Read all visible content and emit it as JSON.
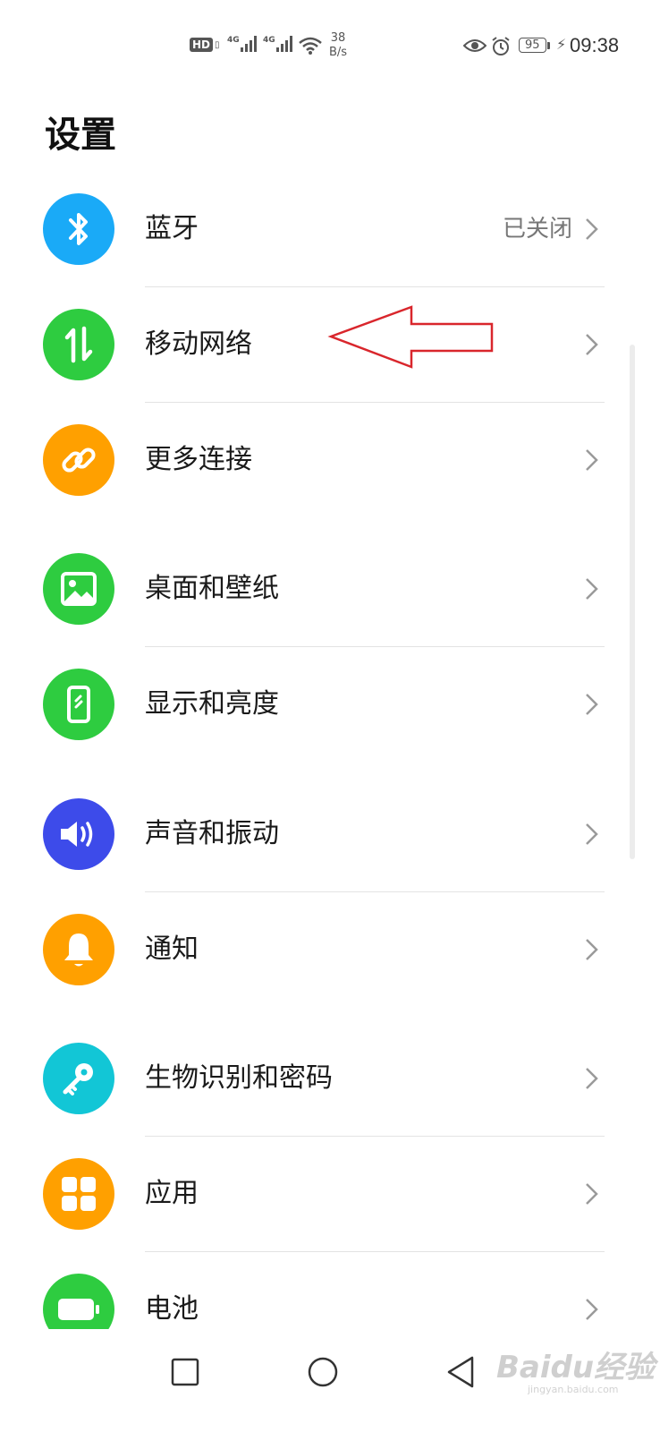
{
  "status_bar": {
    "hd": "HD",
    "signal1_gen": "4G",
    "signal2_gen": "4G",
    "speed_value": "38",
    "speed_unit": "B/s",
    "battery": "95",
    "time": "09:38",
    "icons": [
      "eye-icon",
      "alarm-icon",
      "charging-icon",
      "wifi-icon",
      "signal-icon"
    ]
  },
  "page": {
    "title": "设置"
  },
  "settings": [
    {
      "label": "蓝牙",
      "value": "已关闭",
      "icon": "bluetooth-icon",
      "color": "#1aaaf7"
    },
    {
      "label": "移动网络",
      "value": "",
      "icon": "mobile-data-icon",
      "color": "#2ecc40"
    },
    {
      "label": "更多连接",
      "value": "",
      "icon": "link-icon",
      "color": "#ffa000"
    },
    {
      "label": "桌面和壁纸",
      "value": "",
      "icon": "image-icon",
      "color": "#2ecc40"
    },
    {
      "label": "显示和亮度",
      "value": "",
      "icon": "display-icon",
      "color": "#2ecc40"
    },
    {
      "label": "声音和振动",
      "value": "",
      "icon": "speaker-icon",
      "color": "#3d4bea"
    },
    {
      "label": "通知",
      "value": "",
      "icon": "bell-icon",
      "color": "#ffa000"
    },
    {
      "label": "生物识别和密码",
      "value": "",
      "icon": "key-icon",
      "color": "#12c6d6"
    },
    {
      "label": "应用",
      "value": "",
      "icon": "apps-grid-icon",
      "color": "#ffa000"
    },
    {
      "label": "电池",
      "value": "",
      "icon": "battery-icon",
      "color": "#2ecc40"
    }
  ],
  "annotation": {
    "color": "#d9262c"
  },
  "nav": [
    "recent-apps-icon",
    "home-icon",
    "back-icon"
  ],
  "watermark": {
    "text": "Baidu经验",
    "url": "jingyan.baidu.com"
  }
}
